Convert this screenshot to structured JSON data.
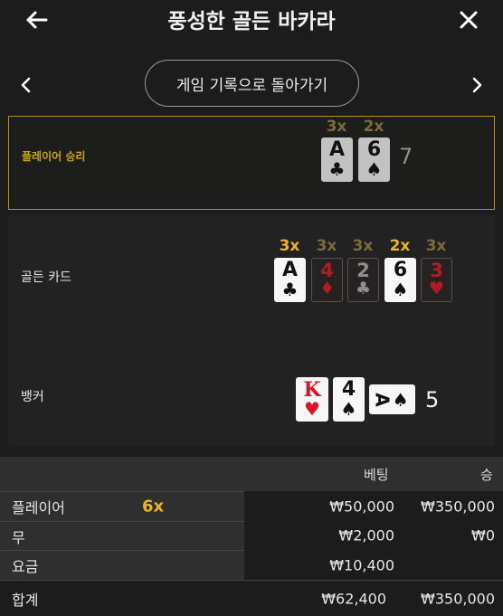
{
  "header": {
    "title": "풍성한 골든 바카라",
    "back_icon": "arrow-left-icon",
    "close_icon": "close-icon"
  },
  "nav": {
    "back_to_history": "게임 기록으로 돌아가기",
    "prev_icon": "chevron-left-icon",
    "next_icon": "chevron-right-icon"
  },
  "player": {
    "label": "플레이어 승리",
    "score": "7",
    "cards": [
      {
        "rank": "A",
        "suit": "♣",
        "multiplier": "3x"
      },
      {
        "rank": "6",
        "suit": "♠",
        "multiplier": "2x"
      }
    ]
  },
  "golden": {
    "label": "골든 카드",
    "cards": [
      {
        "rank": "A",
        "suit": "♣",
        "multiplier": "3x"
      },
      {
        "rank": "4",
        "suit": "♦",
        "multiplier": "3x"
      },
      {
        "rank": "2",
        "suit": "♣",
        "multiplier": "3x"
      },
      {
        "rank": "6",
        "suit": "♠",
        "multiplier": "2x"
      },
      {
        "rank": "3",
        "suit": "♥",
        "multiplier": "3x"
      }
    ]
  },
  "banker": {
    "label": "뱅커",
    "score": "5",
    "cards": [
      {
        "rank": "K",
        "suit": "♥"
      },
      {
        "rank": "4",
        "suit": "♠"
      },
      {
        "rank": "A",
        "suit": "♠"
      }
    ]
  },
  "bets_table": {
    "headers": {
      "bet": "베팅",
      "win": "승"
    },
    "rows": [
      {
        "label": "플레이어",
        "badge": "6x",
        "bet": "₩50,000",
        "win": "₩350,000"
      },
      {
        "label": "무",
        "bet": "₩2,000",
        "win": "₩0"
      },
      {
        "label": "요금",
        "bet": "₩10,400",
        "win": ""
      }
    ],
    "total": {
      "label": "합계",
      "bet": "₩62,400",
      "win": "₩350,000"
    }
  },
  "colors": {
    "gold": "#e8b52a",
    "player_border": "#b9930d",
    "red_suit": "#d8162a",
    "background": "#1c1c1c"
  }
}
